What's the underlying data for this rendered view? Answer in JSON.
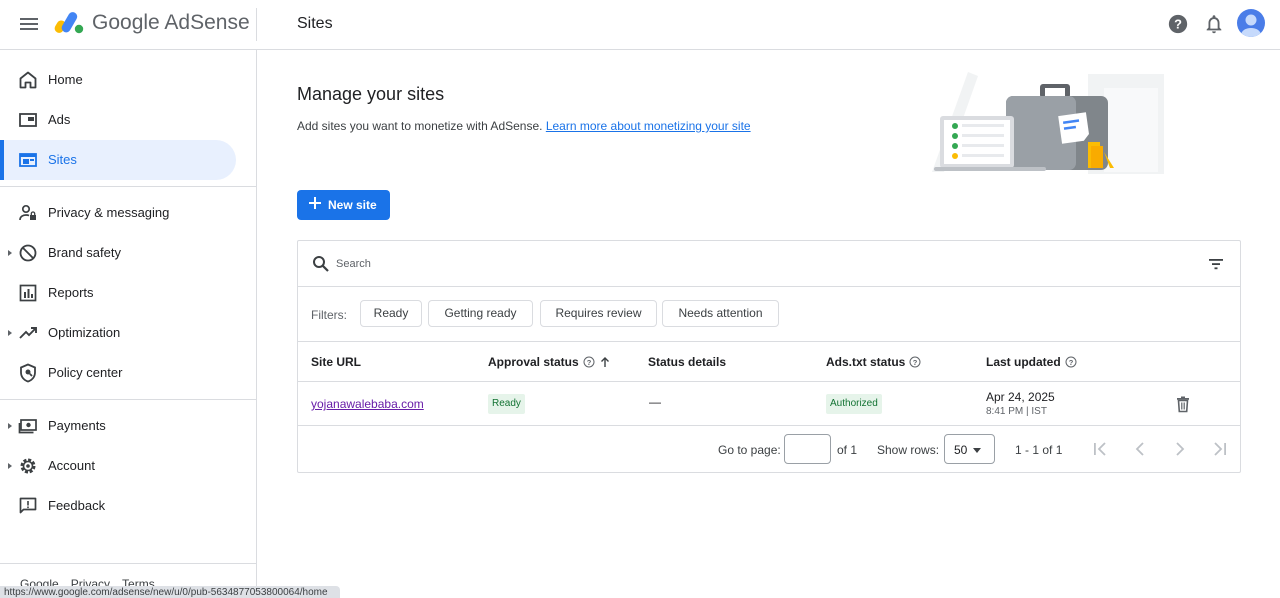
{
  "app": {
    "title": "Google AdSense",
    "page_header": "Sites"
  },
  "colors": {
    "accent": "#1a73e8",
    "active_bg": "#e8f0fe",
    "badge_bg": "#e6f4ea",
    "badge_text": "#137333",
    "visited_link": "#681da8"
  },
  "topbar": {
    "icons": [
      "menu-icon",
      "help-icon",
      "notifications-icon",
      "account-avatar"
    ]
  },
  "sidebar": {
    "items": [
      {
        "label": "Home",
        "icon": "home-icon"
      },
      {
        "label": "Ads",
        "icon": "ads-icon"
      },
      {
        "label": "Sites",
        "icon": "sites-icon",
        "active": true
      },
      {
        "label": "Privacy & messaging",
        "icon": "privacy-icon"
      },
      {
        "label": "Brand safety",
        "icon": "block-icon",
        "expandable": true
      },
      {
        "label": "Reports",
        "icon": "reports-icon"
      },
      {
        "label": "Optimization",
        "icon": "trending-icon",
        "expandable": true
      },
      {
        "label": "Policy center",
        "icon": "policy-shield-icon"
      },
      {
        "label": "Payments",
        "icon": "payments-icon",
        "expandable": true
      },
      {
        "label": "Account",
        "icon": "settings-gear-icon",
        "expandable": true
      },
      {
        "label": "Feedback",
        "icon": "feedback-icon"
      }
    ],
    "footer": {
      "google": "Google",
      "privacy": "Privacy",
      "terms": "Terms"
    }
  },
  "status_bar": {
    "url": "https://www.google.com/adsense/new/u/0/pub-5634877053800064/home"
  },
  "main": {
    "title": "Manage your sites",
    "description": "Add sites you want to monetize with AdSense.",
    "learn_more": "Learn more about monetizing your site",
    "new_site_button": "New site"
  },
  "table": {
    "search_placeholder": "Search",
    "filters_label": "Filters:",
    "filters": [
      "Ready",
      "Getting ready",
      "Requires review",
      "Needs attention"
    ],
    "columns": {
      "site_url": "Site URL",
      "approval_status": "Approval status",
      "status_details": "Status details",
      "ads_txt_status": "Ads.txt status",
      "last_updated": "Last updated"
    },
    "rows": [
      {
        "site_url": "yojanawalebaba.com",
        "approval_status": "Ready",
        "status_details": "—",
        "ads_txt_status": "Authorized",
        "last_updated_date": "Apr 24, 2025",
        "last_updated_time": "8:41 PM | IST"
      }
    ],
    "pagination": {
      "go_to_page_label": "Go to page:",
      "page_input_value": "",
      "of_pages": "of 1",
      "show_rows_label": "Show rows:",
      "rows_per_page": "50",
      "range": "1 - 1 of 1"
    }
  }
}
